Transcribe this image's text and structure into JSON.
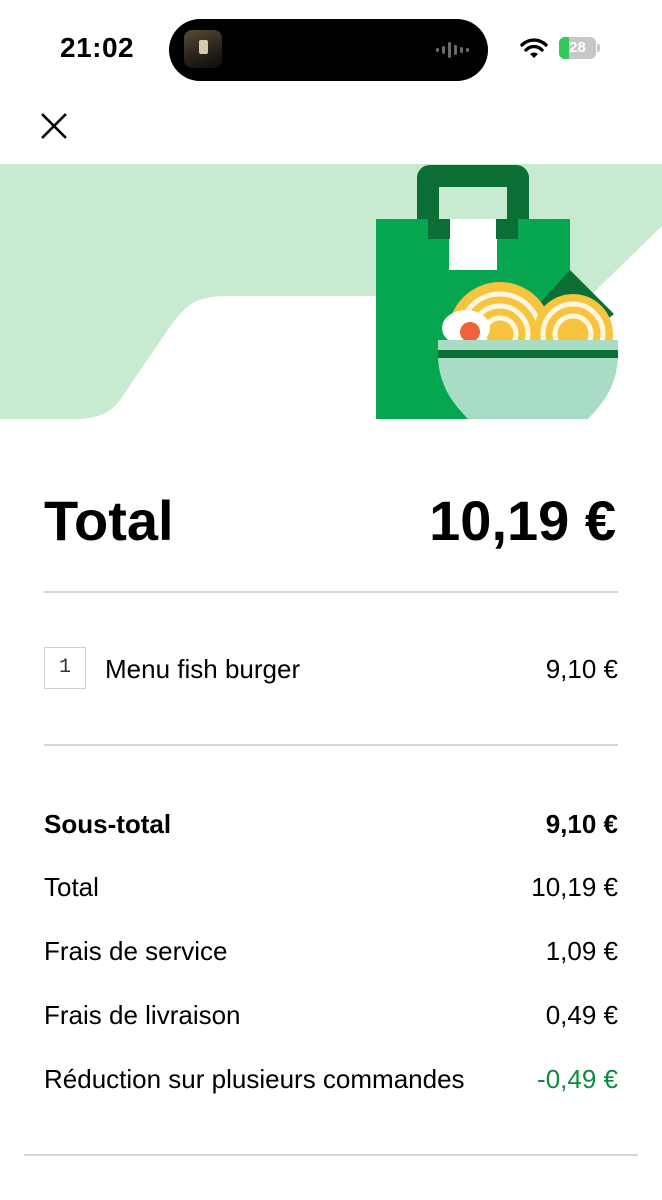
{
  "status_bar": {
    "time": "21:02",
    "battery_level": "28",
    "battery_fraction": 0.28,
    "icons": [
      "wifi-icon",
      "battery-icon",
      "charging-icon",
      "waveform-icon"
    ]
  },
  "header": {
    "close_icon": "close-icon"
  },
  "banner": {
    "illustration": "shopping-bag-with-noodle-bowl",
    "colors": {
      "light_green": "#c7ead1",
      "bag_green": "#06a651",
      "dark_green": "#0b6e34",
      "bowl": "#a8dcc4",
      "noodle": "#f6c43f"
    }
  },
  "summary_header": {
    "title": "Total",
    "amount": "10,19 €"
  },
  "items": [
    {
      "quantity": "1",
      "name": "Menu fish burger",
      "price": "9,10 €"
    }
  ],
  "breakdown": {
    "subtotal": {
      "label": "Sous-total",
      "value": "9,10 €"
    },
    "total": {
      "label": "Total",
      "value": "10,19 €"
    },
    "service_fee": {
      "label": "Frais de service",
      "value": "1,09 €"
    },
    "delivery_fee": {
      "label": "Frais de livraison",
      "value": "0,49 €"
    },
    "discount": {
      "label": "Réduction sur plusieurs commandes",
      "value": "-0,49 €"
    }
  },
  "colors": {
    "discount_green": "#0e8a3e",
    "divider": "#d6d6d6"
  }
}
